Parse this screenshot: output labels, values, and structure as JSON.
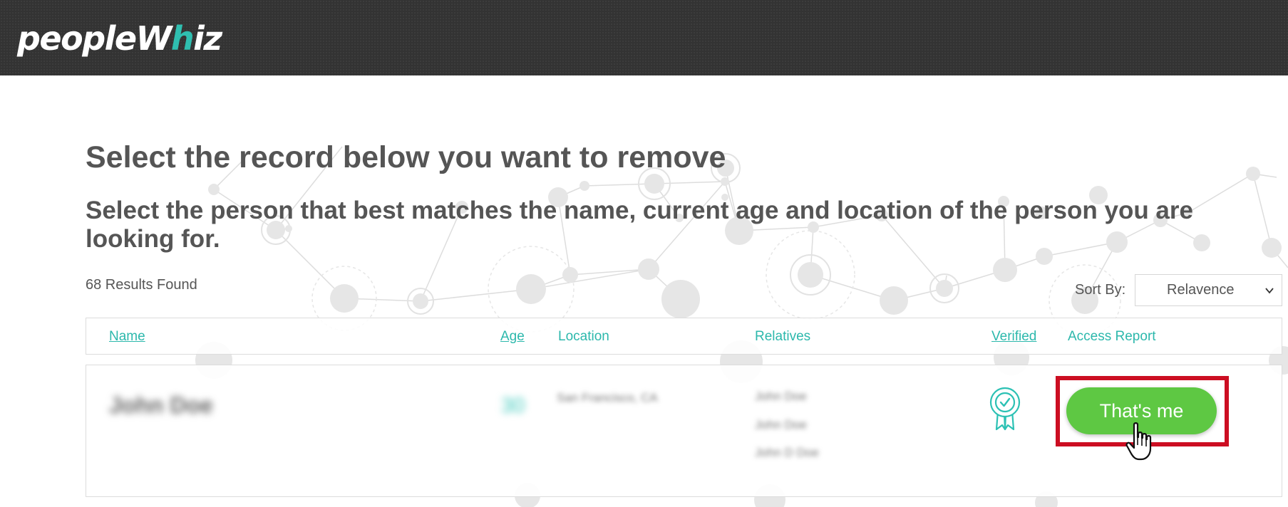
{
  "header": {
    "logo_text_main": "peopleW",
    "logo_dot": "h",
    "logo_text_end": "iz",
    "logo_accent_color": "#2fbfb0"
  },
  "page": {
    "title": "Select the record below you want to remove",
    "subtitle": "Select the person that best matches the name, current age and location of the person you are looking for.",
    "results_count": "68 Results Found"
  },
  "sort": {
    "label": "Sort By:",
    "selected": "Relavence"
  },
  "table": {
    "columns": {
      "name": "Name",
      "age": "Age",
      "location": "Location",
      "relatives": "Relatives",
      "verified": "Verified",
      "access_report": "Access Report"
    },
    "accent_color": "#2cb8ac"
  },
  "record": {
    "name": "John Doe",
    "age": "30",
    "location": "San Francisco, CA",
    "relatives": [
      "John Doe",
      "John Doe",
      "John D Doe"
    ],
    "verified_icon": "verified-ribbon-icon",
    "action_label": "That's me",
    "action_color": "#5ec843",
    "highlight_color": "#cc0e22"
  }
}
